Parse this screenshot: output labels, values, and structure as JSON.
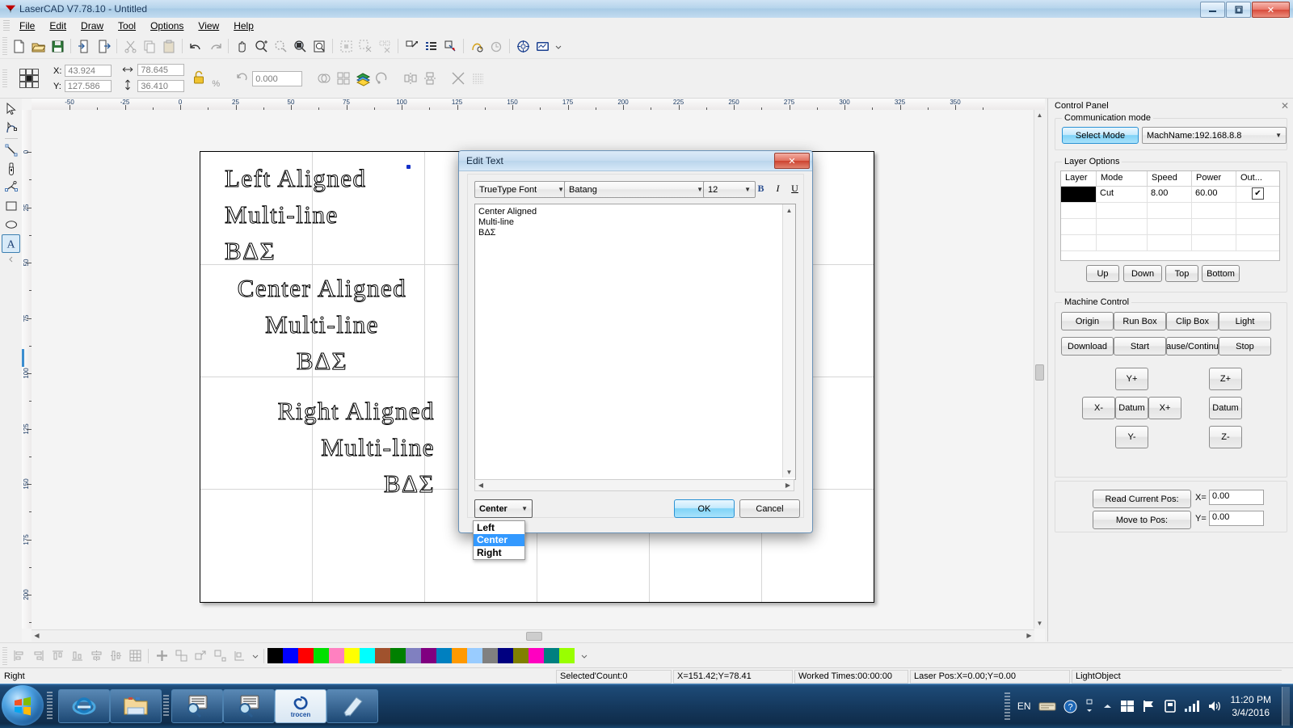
{
  "window": {
    "title": "LaserCAD V7.78.10 - Untitled",
    "minimize": "–",
    "maximize": "❐",
    "close": "✕"
  },
  "menu": [
    "File",
    "Edit",
    "Draw",
    "Tool",
    "Options",
    "View",
    "Help"
  ],
  "properties_toolbar": {
    "x_label": "X:",
    "x_value": "43.924",
    "y_label": "Y:",
    "y_value": "127.586",
    "width_value": "78.645",
    "height_value": "36.410",
    "percent_label": "%",
    "angle_value": "0.000"
  },
  "rulers": {
    "horizontal_ticks": [
      "-50",
      "-25",
      "0",
      "25",
      "50",
      "75",
      "100",
      "125",
      "150",
      "175",
      "200",
      "225",
      "250",
      "275",
      "300",
      "325",
      "350"
    ],
    "vertical_ticks": [
      "0",
      "25",
      "50",
      "75",
      "100",
      "125",
      "150",
      "175",
      "200"
    ]
  },
  "canvas": {
    "objects": [
      {
        "name": "left-aligned-text",
        "lines": [
          "Left Aligned",
          "Multi-line",
          "BΔΣ"
        ],
        "align": "left"
      },
      {
        "name": "center-aligned-text",
        "lines": [
          "Center Aligned",
          "Multi-line",
          "BΔΣ"
        ],
        "align": "center"
      },
      {
        "name": "right-aligned-text",
        "lines": [
          "Right Aligned",
          "Multi-line",
          "BΔΣ"
        ],
        "align": "right"
      }
    ]
  },
  "dialog": {
    "title": "Edit Text",
    "close_label": "✕",
    "font_type": "TrueType Font",
    "font_name": "Batang",
    "font_size": "12",
    "bold_label": "B",
    "italic_label": "I",
    "underline_label": "U",
    "content": "Center Aligned\nMulti-line\nBΔΣ",
    "align_selected": "Center",
    "align_options": [
      "Left",
      "Center",
      "Right"
    ],
    "ok_label": "OK",
    "cancel_label": "Cancel"
  },
  "control_panel": {
    "title": "Control Panel",
    "close_label": "✕",
    "communication": {
      "group_label": "Communication mode",
      "select_mode_label": "Select Mode",
      "machine_name": "MachName:192.168.8.8"
    },
    "layer_options": {
      "group_label": "Layer Options",
      "columns": [
        "Layer",
        "Mode",
        "Speed",
        "Power",
        "Out..."
      ],
      "rows": [
        {
          "layer_color": "#000000",
          "mode": "Cut",
          "speed": "8.00",
          "power": "60.00",
          "output": true
        }
      ],
      "order_buttons": [
        "Up",
        "Down",
        "Top",
        "Bottom"
      ]
    },
    "machine_control": {
      "group_label": "Machine Control",
      "buttons_row1": [
        "Origin",
        "Run Box",
        "Clip Box",
        "Light"
      ],
      "buttons_row2": [
        "Download",
        "Start",
        "ause/Continu",
        "Stop"
      ],
      "jog_xy": [
        "Y+",
        "X-",
        "Datum",
        "X+",
        "Y-"
      ],
      "jog_z": [
        "Z+",
        "Datum",
        "Z-"
      ]
    },
    "position": {
      "read_current_pos_label": "Read Current Pos:",
      "move_to_pos_label": "Move to Pos:",
      "x_label": "X=",
      "x_value": "0.00",
      "y_label": "Y=",
      "y_value": "0.00"
    }
  },
  "palette": {
    "colors": [
      "#000000",
      "#0000ff",
      "#ff0000",
      "#00e000",
      "#ff80c0",
      "#ffff00",
      "#00ffff",
      "#a0522d",
      "#008000",
      "#8080c0",
      "#800080",
      "#0080c0",
      "#ff9900",
      "#99ccff",
      "#808080",
      "#000080",
      "#808000",
      "#ff00c0",
      "#008080",
      "#99ff00"
    ]
  },
  "statusbar": {
    "mode": "Right",
    "selected_count": "Selected'Count:0",
    "cursor_pos": "X=151.42;Y=78.41",
    "worked_times": "Worked Times:00:00:00",
    "laser_pos": "Laser Pos:X=0.00;Y=0.00",
    "light_object": "LightObject"
  },
  "taskbar": {
    "apps": [
      "internet-explorer",
      "file-explorer",
      "laser-app-1",
      "laser-app-2",
      "trocen-app",
      "notepad-app"
    ],
    "trocen_label": "trocen",
    "language": "EN",
    "time": "11:20 PM",
    "date": "3/4/2016"
  }
}
